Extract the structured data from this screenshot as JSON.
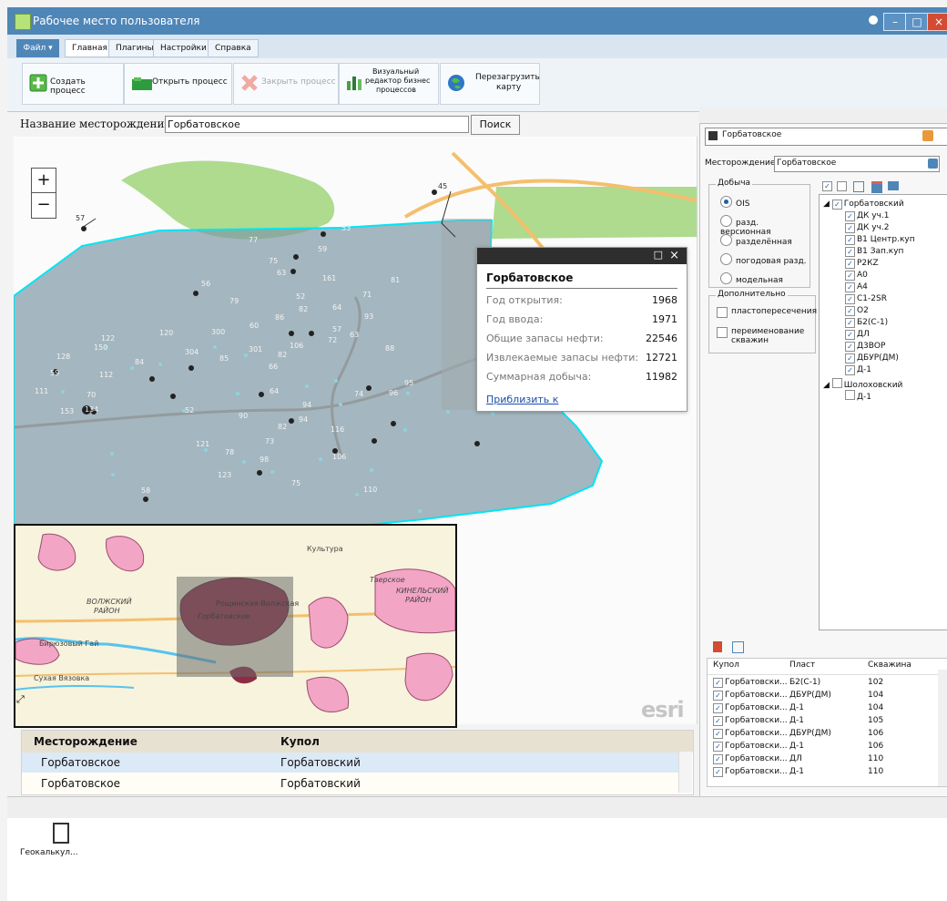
{
  "window": {
    "title": "Рабочее место пользователя",
    "buttons": {
      "minimize": "–",
      "maximize": "□",
      "close": "×"
    }
  },
  "menu": {
    "file": "Файл ▾",
    "tabs": [
      "Главная",
      "Плагины",
      "Настройки",
      "Справка"
    ]
  },
  "ribbon": {
    "create_process": "Создать процесс",
    "open_process": "Открыть процесс",
    "close_process": "Закрыть процесс",
    "visual_editor_1": "Визуальный",
    "visual_editor_2": "редактор бизнес",
    "visual_editor_3": "процессов",
    "reload_map_1": "Перезагрузить",
    "reload_map_2": "карту"
  },
  "search": {
    "label": "Название месторождения:",
    "value": "Горбатовское",
    "button": "Поиск"
  },
  "map": {
    "zoom_in": "+",
    "zoom_out": "−",
    "field_name": "Горбатовское",
    "well_labels": [
      "57",
      "45",
      "53",
      "59",
      "77",
      "75",
      "63",
      "161",
      "81",
      "56",
      "79",
      "52",
      "64",
      "82",
      "71",
      "93",
      "120",
      "300",
      "60",
      "86",
      "57",
      "63",
      "122",
      "150",
      "128",
      "112",
      "84",
      "304",
      "85",
      "301",
      "82",
      "106",
      "72",
      "88",
      "111",
      "70",
      "153",
      "134",
      "59",
      "94",
      "64",
      "82",
      "66",
      "52",
      "90",
      "94",
      "116",
      "74",
      "95",
      "121",
      "78",
      "73",
      "98",
      "123",
      "75",
      "106",
      "96",
      "110",
      "58"
    ]
  },
  "popup": {
    "title": "Горбатовское",
    "rows": [
      {
        "label": "Год открытия:",
        "value": "1968"
      },
      {
        "label": "Год ввода:",
        "value": "1971"
      },
      {
        "label": "Общие запасы нефти:",
        "value": "22546"
      },
      {
        "label": "Извлекаемые запасы нефти:",
        "value": "12721"
      },
      {
        "label": "Суммарная добыча:",
        "value": "11982"
      }
    ],
    "zoom_link": "Приблизить к"
  },
  "overview": {
    "labels": [
      "Культура",
      "Тверское",
      "КИНЕЛЬСКИЙ",
      "РАЙОН",
      "ВОЛЖСКИЙ",
      "РАЙОН",
      "Горбатовское",
      "Бирюзовый Гай",
      "Сухая Вязовка",
      "Рощинская-Волжская"
    ]
  },
  "esri_logo": "esri",
  "grid": {
    "headers": [
      "Месторождение",
      "Купол"
    ],
    "rows": [
      {
        "field": "Горбатовское",
        "dome": "Горбатовский"
      },
      {
        "field": "Горбатовское",
        "dome": "Горбатовский"
      }
    ]
  },
  "tray": {
    "app_label": "Геокалькул..."
  },
  "right_panel": {
    "layer_combo": "Горбатовское",
    "field_label": "Месторождение",
    "field_value": "Горбатовское",
    "production": {
      "title": "Добыча",
      "options": [
        "OIS",
        "разд. версионная",
        "разделённая",
        "погодовая разд.",
        "модельная"
      ],
      "selected": "OIS"
    },
    "extra": {
      "title": "Дополнительно",
      "options": [
        "пластопересечения",
        "переименование скважин"
      ]
    },
    "tree": {
      "root1": "Горбатовский",
      "children1": [
        "ДК уч.1",
        "ДК уч.2",
        "В1 Центр.куп",
        "В1 Зап.куп",
        "Р2КZ",
        "А0",
        "А4",
        "С1-2SR",
        "О2",
        "Б2(С-1)",
        "ДЛ",
        "Д3ВОР",
        "ДБУР(ДМ)",
        "Д-1"
      ],
      "root2": "Шолоховский",
      "children2": [
        "Д-1"
      ]
    },
    "table": {
      "headers": [
        "Купол",
        "Пласт",
        "Скважина"
      ],
      "rows": [
        {
          "dome": "Горбатовски...",
          "layer": "Б2(С-1)",
          "well": "102"
        },
        {
          "dome": "Горбатовски...",
          "layer": "ДБУР(ДМ)",
          "well": "104"
        },
        {
          "dome": "Горбатовски...",
          "layer": "Д-1",
          "well": "104"
        },
        {
          "dome": "Горбатовски...",
          "layer": "Д-1",
          "well": "105"
        },
        {
          "dome": "Горбатовски...",
          "layer": "ДБУР(ДМ)",
          "well": "106"
        },
        {
          "dome": "Горбатовски...",
          "layer": "Д-1",
          "well": "106"
        },
        {
          "dome": "Горбатовски...",
          "layer": "ДЛ",
          "well": "110"
        },
        {
          "dome": "Горбатовски...",
          "layer": "Д-1",
          "well": "110"
        }
      ]
    }
  },
  "colors": {
    "accent": "#4f86b8",
    "field_fill": "#7f98a5",
    "field_border": "#00e5f5",
    "green": "#aedb8e",
    "road": "#f6c97d",
    "pink": "#f3a5c5"
  }
}
